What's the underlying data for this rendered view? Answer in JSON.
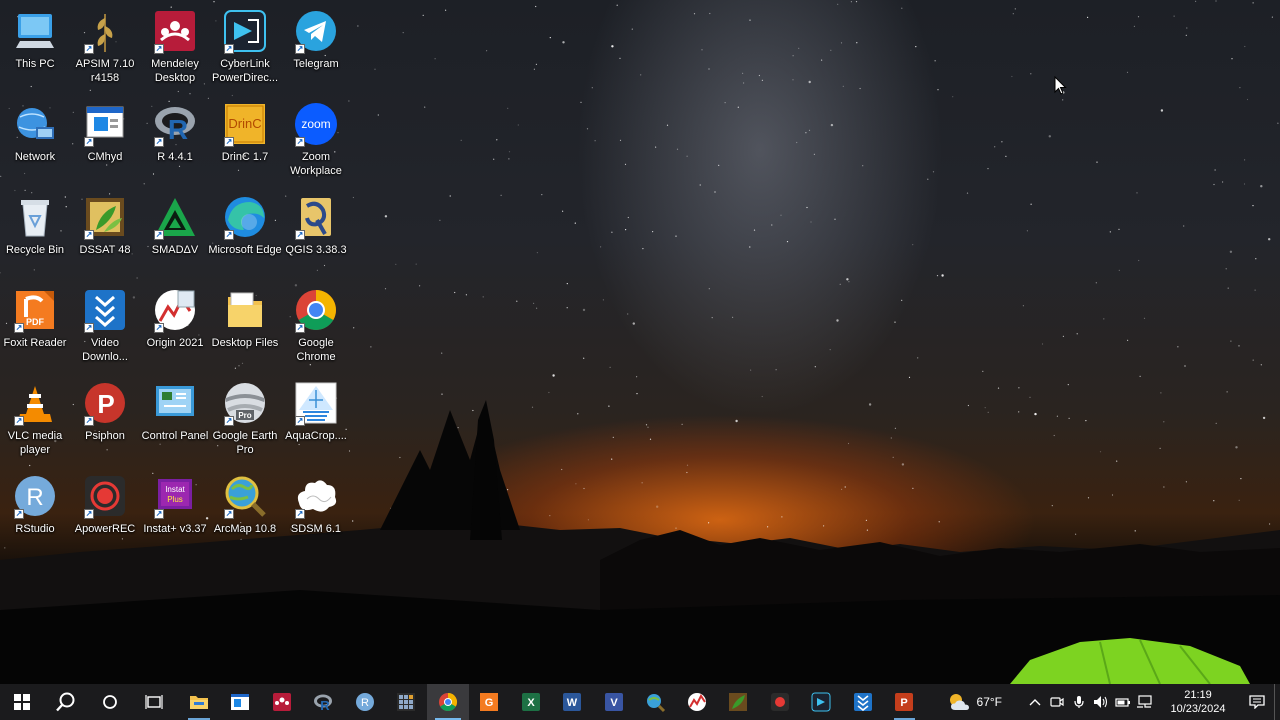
{
  "desktop": {
    "icons": [
      {
        "label": "This PC",
        "icon": "computer-icon"
      },
      {
        "label": "APSIM 7.10 r4158",
        "icon": "apsim-icon"
      },
      {
        "label": "Mendeley Desktop",
        "icon": "mendeley-icon"
      },
      {
        "label": "CyberLink PowerDirec...",
        "icon": "powerdirector-icon"
      },
      {
        "label": "Telegram",
        "icon": "telegram-icon"
      },
      {
        "label": "Network",
        "icon": "network-icon"
      },
      {
        "label": "CMhyd",
        "icon": "cmhyd-icon"
      },
      {
        "label": "R 4.4.1",
        "icon": "r-icon"
      },
      {
        "label": "DrinC 1.7",
        "icon": "drinc-icon"
      },
      {
        "label": "Zoom Workplace",
        "icon": "zoom-icon"
      },
      {
        "label": "Recycle Bin",
        "icon": "recycle-bin-icon"
      },
      {
        "label": "DSSAT 48",
        "icon": "dssat-icon"
      },
      {
        "label": "SMADΔV",
        "icon": "smadav-icon"
      },
      {
        "label": "Microsoft Edge",
        "icon": "edge-icon"
      },
      {
        "label": "QGIS 3.38.3",
        "icon": "qgis-icon"
      },
      {
        "label": "Foxit Reader",
        "icon": "foxit-icon"
      },
      {
        "label": "Video Downlo...",
        "icon": "video-downloader-icon"
      },
      {
        "label": "Origin 2021",
        "icon": "origin-icon"
      },
      {
        "label": "Desktop Files",
        "icon": "folder-icon"
      },
      {
        "label": "Google Chrome",
        "icon": "chrome-icon"
      },
      {
        "label": "VLC media player",
        "icon": "vlc-icon"
      },
      {
        "label": "Psiphon",
        "icon": "psiphon-icon"
      },
      {
        "label": "Control Panel",
        "icon": "control-panel-icon"
      },
      {
        "label": "Google Earth Pro",
        "icon": "google-earth-icon"
      },
      {
        "label": "AquaCrop....",
        "icon": "aquacrop-icon"
      },
      {
        "label": "RStudio",
        "icon": "rstudio-icon"
      },
      {
        "label": "ApowerREC",
        "icon": "apowerrec-icon"
      },
      {
        "label": "Instat+ v3.37",
        "icon": "instat-icon"
      },
      {
        "label": "ArcMap 10.8",
        "icon": "arcmap-icon"
      },
      {
        "label": "SDSM 6.1",
        "icon": "sdsm-icon"
      }
    ],
    "icon_texts": {
      "drinc": "DrinC",
      "zoom": "zoom",
      "pdf": "PDF",
      "pro": "Pro",
      "instat_top": "Instat",
      "instat_bottom": "Plus",
      "r": "R"
    }
  },
  "taskbar": {
    "apps": [
      {
        "icon": "file-explorer-icon",
        "state": "running"
      },
      {
        "icon": "cmhyd-taskbar-icon",
        "state": ""
      },
      {
        "icon": "mendeley-taskbar-icon",
        "state": ""
      },
      {
        "icon": "r-taskbar-icon",
        "state": ""
      },
      {
        "icon": "rstudio-taskbar-icon",
        "state": ""
      },
      {
        "icon": "calculator-grid-icon",
        "state": ""
      },
      {
        "icon": "chrome-taskbar-icon",
        "state": "active"
      },
      {
        "icon": "foxit-taskbar-icon",
        "state": ""
      },
      {
        "icon": "excel-icon",
        "state": ""
      },
      {
        "icon": "word-icon",
        "state": ""
      },
      {
        "icon": "visio-icon",
        "state": ""
      },
      {
        "icon": "search-globe-icon",
        "state": ""
      },
      {
        "icon": "origin-taskbar-icon",
        "state": ""
      },
      {
        "icon": "dssat-taskbar-icon",
        "state": ""
      },
      {
        "icon": "apowerrec-taskbar-icon",
        "state": ""
      },
      {
        "icon": "powerdirector-taskbar-icon",
        "state": ""
      },
      {
        "icon": "video-downloader-taskbar-icon",
        "state": ""
      },
      {
        "icon": "powerpoint-icon",
        "state": "running"
      }
    ],
    "weather": {
      "temp": "67°F",
      "icon": "partly-cloudy-icon"
    },
    "clock": {
      "time": "21:19",
      "date": "10/23/2024"
    },
    "text_glyphs": {
      "r": "R",
      "excel": "X",
      "word": "W",
      "visio": "V",
      "ppt": "P",
      "pdf": "G"
    }
  },
  "colors": {
    "taskbar_bg": "#1b1b1d",
    "accent": "#76b9ed"
  }
}
